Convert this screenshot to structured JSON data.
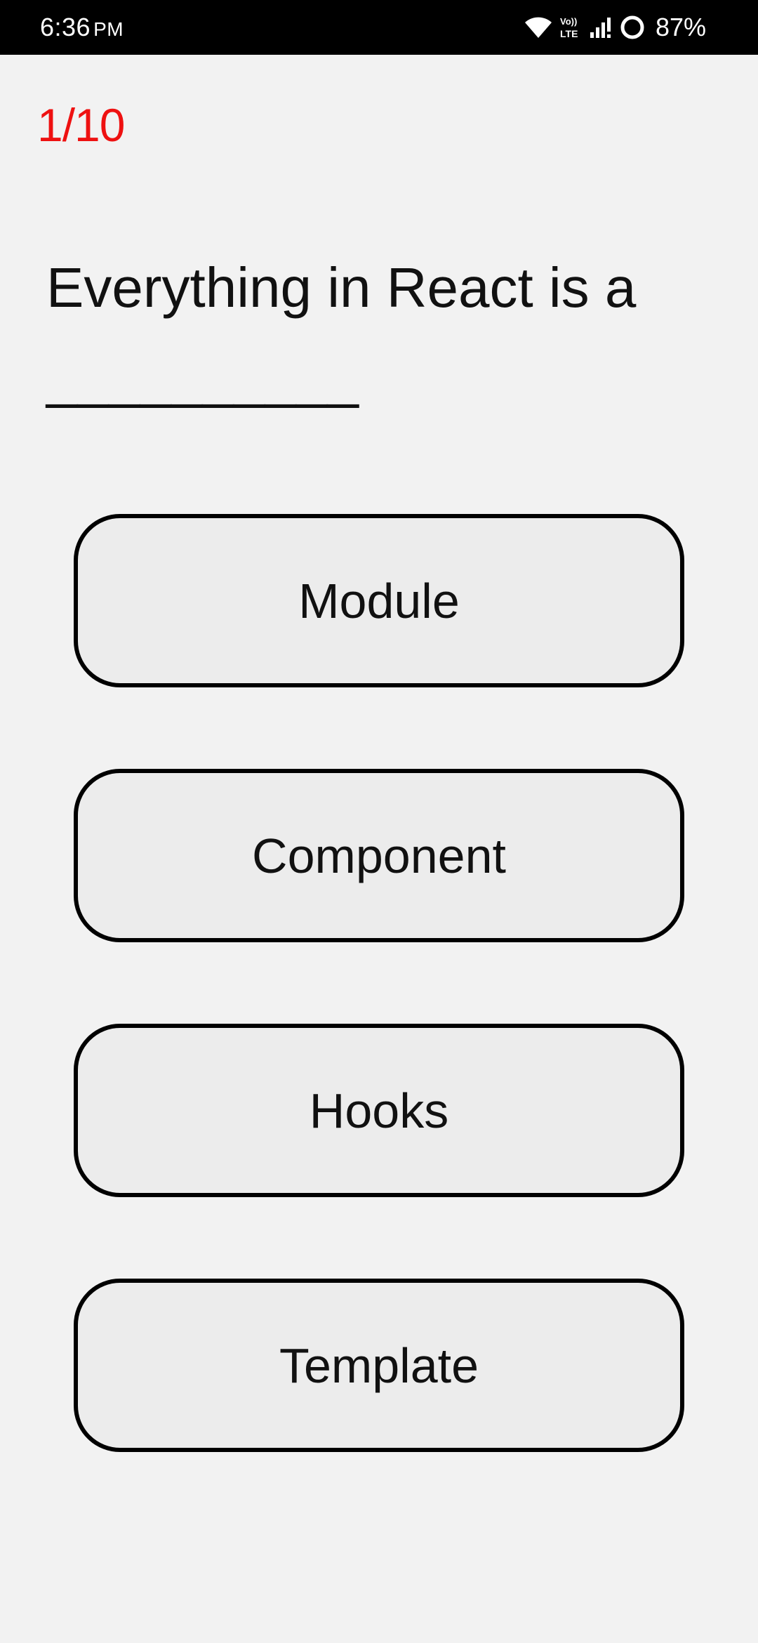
{
  "status_bar": {
    "time": "6:36",
    "ampm": "PM",
    "battery_percent": "87%",
    "icons": [
      "wifi-icon",
      "volte-icon",
      "signal-icon",
      "battery-ring-icon"
    ]
  },
  "quiz": {
    "progress": "1/10",
    "question": "Everything in React is a __________",
    "options": [
      {
        "label": "Module"
      },
      {
        "label": "Component"
      },
      {
        "label": "Hooks"
      },
      {
        "label": "Template"
      }
    ]
  },
  "colors": {
    "progress": "#ee1111",
    "background": "#f2f2f2",
    "button_fill": "#ececec",
    "button_border": "#000000"
  }
}
